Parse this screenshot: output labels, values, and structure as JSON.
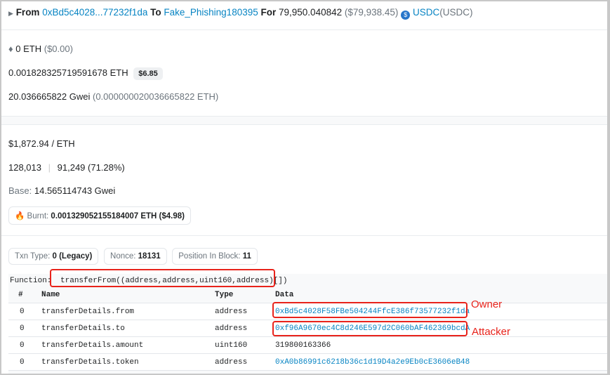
{
  "transfer": {
    "from_label": "From",
    "from_addr": "0xBd5c4028...77232f1da",
    "to_label": "To",
    "to_name": "Fake_Phishing180395",
    "for_label": "For",
    "amount": "79,950.040842",
    "amount_usd": "($79,938.45)",
    "token": "USDC",
    "token_sym": "(USDC)"
  },
  "value": {
    "eth": "0 ETH",
    "usd": "($0.00)"
  },
  "fee": {
    "eth": "0.001828325719591678 ETH",
    "usd": "$6.85"
  },
  "gas_price": {
    "gwei": "20.036665822 Gwei",
    "eth": "(0.000000020036665822 ETH)"
  },
  "eth_price": "$1,872.94 / ETH",
  "gas": {
    "limit": "128,013",
    "sep": "|",
    "used": "91,249 (71.28%)"
  },
  "base": {
    "label": "Base:",
    "value": "14.565114743 Gwei"
  },
  "burnt": {
    "label": "Burnt:",
    "value": "0.001329052155184007 ETH ($4.98)"
  },
  "chips": [
    {
      "label": "Txn Type:",
      "value": "0 (Legacy)"
    },
    {
      "label": "Nonce:",
      "value": "18131"
    },
    {
      "label": "Position In Block:",
      "value": "11"
    }
  ],
  "function": {
    "label": "Function:",
    "sig": "transferFrom((address,address,uint160,address)[])"
  },
  "table": {
    "headers": [
      "#",
      "Name",
      "Type",
      "Data"
    ],
    "rows": [
      {
        "idx": "0",
        "name": "transferDetails.from",
        "type": "address",
        "data": "0xBd5c4028F58FBe504244FfcE386f73577232f1da"
      },
      {
        "idx": "0",
        "name": "transferDetails.to",
        "type": "address",
        "data": "0xf96A9670ec4C8d246E597d2C060bAF462369bcdA"
      },
      {
        "idx": "0",
        "name": "transferDetails.amount",
        "type": "uint160",
        "data": "319800163366"
      },
      {
        "idx": "0",
        "name": "transferDetails.token",
        "type": "address",
        "data": "0xA0b86991c6218b36c1d19D4a2e9Eb0cE3606eB48"
      }
    ]
  },
  "annotations": {
    "owner": "Owner",
    "attacker": "Attacker"
  }
}
